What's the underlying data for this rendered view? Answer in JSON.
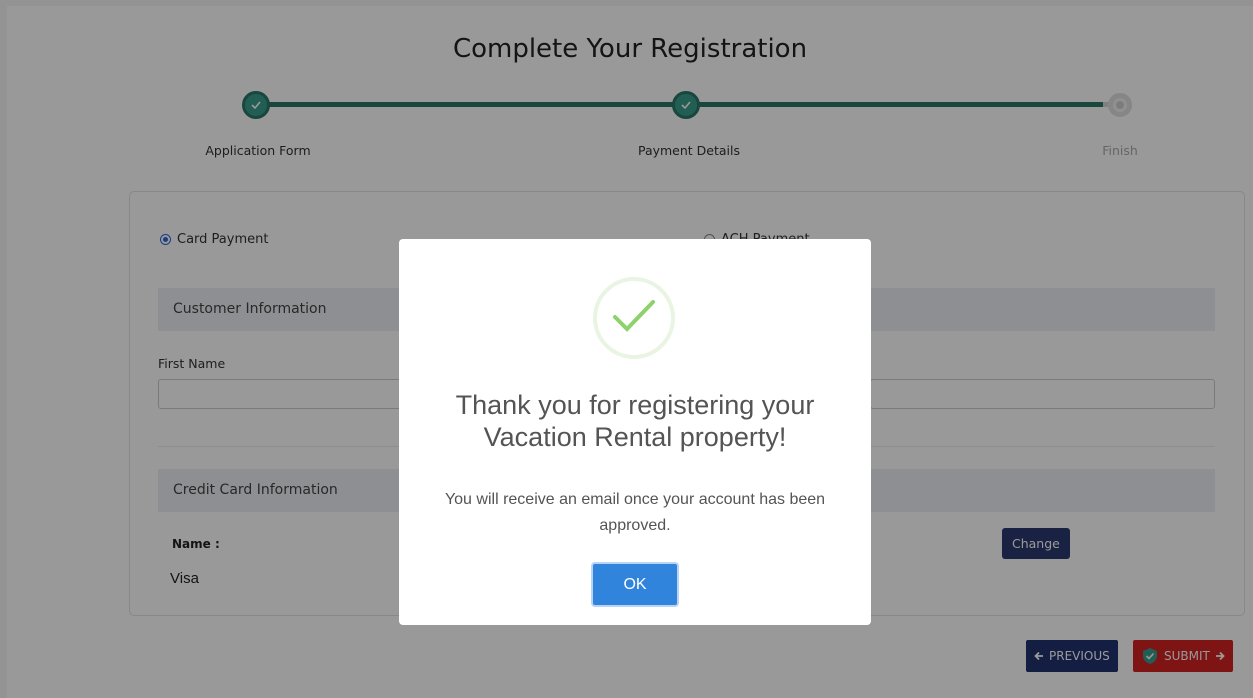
{
  "page": {
    "title": "Complete Your Registration"
  },
  "steps": [
    {
      "label": "Application Form",
      "status": "done"
    },
    {
      "label": "Payment Details",
      "status": "done"
    },
    {
      "label": "Finish",
      "status": "todo"
    }
  ],
  "payment": {
    "options": [
      {
        "label": "Card Payment",
        "selected": true
      },
      {
        "label": "ACH Payment",
        "selected": false
      }
    ],
    "customer_section": "Customer Information",
    "first_name_label": "First Name",
    "credit_section": "Credit Card Information",
    "name_label": "Name :",
    "card_name": "Visa",
    "change_label": "Change"
  },
  "nav": {
    "previous_label": "PREVIOUS",
    "submit_label": "SUBMIT"
  },
  "modal": {
    "title": "Thank you for registering your Vacation Rental property!",
    "message": "You will receive an email once your account has been approved.",
    "ok_label": "OK"
  },
  "colors": {
    "accent": "#2b7567",
    "modal_button": "#3184dc",
    "submit": "#d32222",
    "previous": "#22326e"
  },
  "icons": {
    "step_done": "check-icon",
    "success": "check-icon",
    "previous": "arrow-left-icon",
    "submit": "arrow-right-icon",
    "submit_badge": "shield-check-icon"
  }
}
